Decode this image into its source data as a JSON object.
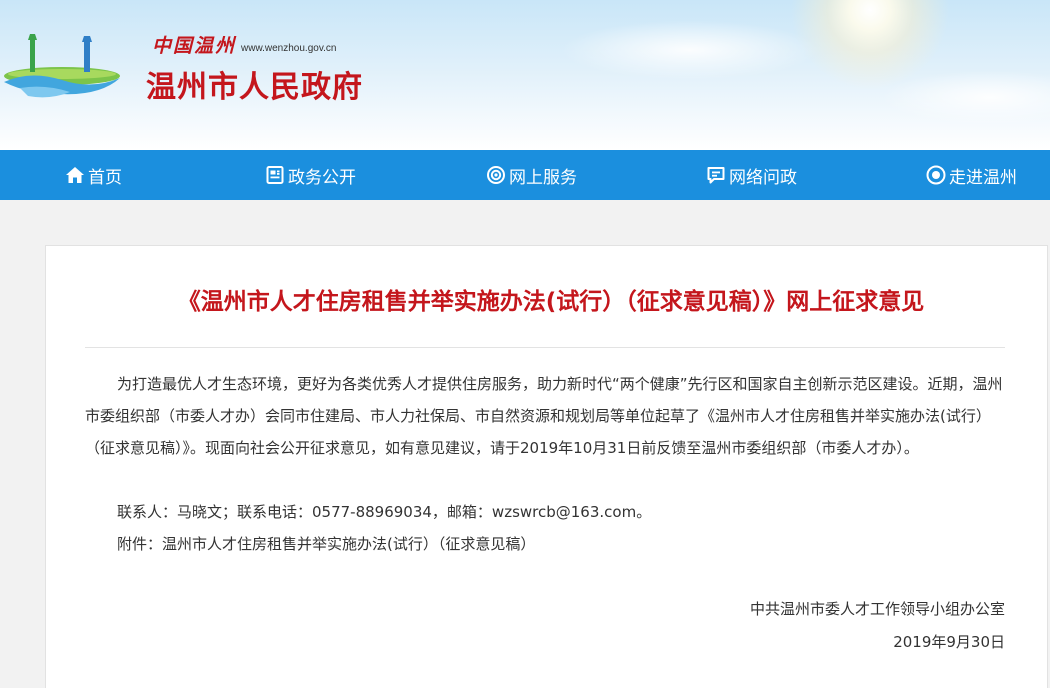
{
  "header": {
    "site_name_cn": "中国温州",
    "site_url": "www.wenzhou.gov.cn",
    "title": "温州市人民政府"
  },
  "nav": {
    "items": [
      {
        "label": "首页",
        "icon": "home-icon"
      },
      {
        "label": "政务公开",
        "icon": "document-icon"
      },
      {
        "label": "网上服务",
        "icon": "service-icon"
      },
      {
        "label": "网络问政",
        "icon": "chat-icon"
      },
      {
        "label": "走进温州",
        "icon": "eye-icon"
      }
    ]
  },
  "article": {
    "title": "《温州市人才住房租售并举实施办法(试行）（征求意见稿）》网上征求意见",
    "body": "为打造最优人才生态环境，更好为各类优秀人才提供住房服务，助力新时代“两个健康”先行区和国家自主创新示范区建设。近期，温州市委组织部（市委人才办）会同市住建局、市人力社保局、市自然资源和规划局等单位起草了《温州市人才住房租售并举实施办法(试行）（征求意见稿）》。现面向社会公开征求意见，如有意见建议，请于2019年10月31日前反馈至温州市委组织部（市委人才办）。",
    "contact": "联系人：马晓文；联系电话：0577-88969034，邮箱：wzswrcb@163.com。",
    "attachment_prefix": "附件：",
    "attachment_link": "温州市人才住房租售并举实施办法(试行）（征求意见稿）",
    "signature_org": "中共温州市委人才工作领导小组办公室",
    "signature_date": "2019年9月30日"
  },
  "colors": {
    "brand_red": "#c4161c",
    "nav_blue": "#1b8fde"
  }
}
